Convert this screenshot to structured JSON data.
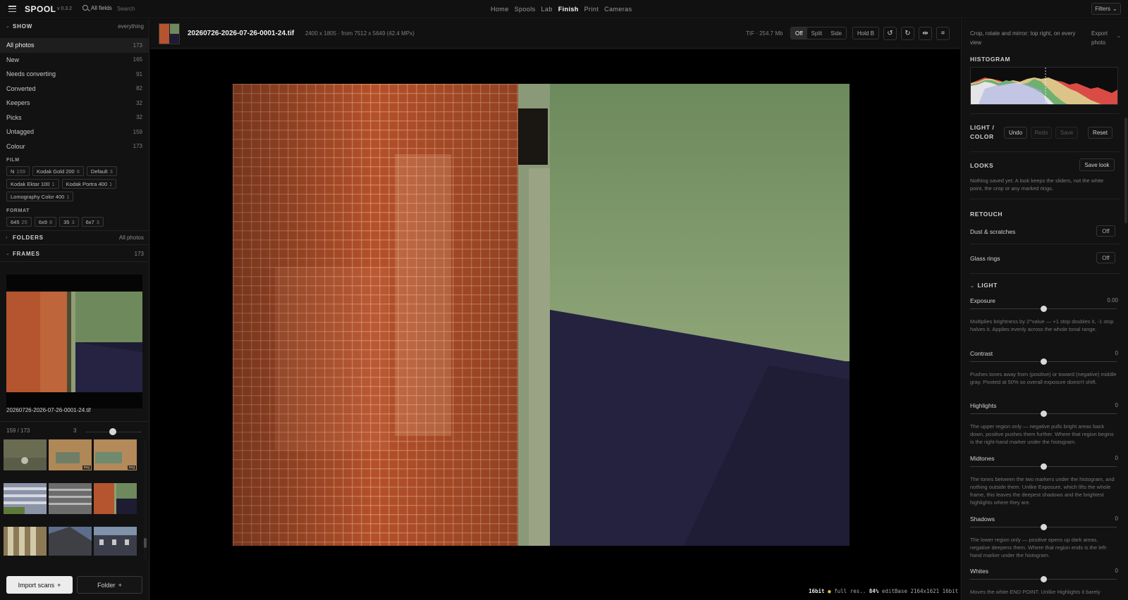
{
  "topbar": {
    "brand": "SPOOL",
    "version": "v 0.3.2",
    "search_scope": "All fields",
    "search_placeholder": "Search",
    "nav": [
      "Home",
      "Spools",
      "Lab",
      "Finish",
      "Print",
      "Cameras"
    ],
    "nav_active": "Finish",
    "filters_label": "Filters"
  },
  "sidebar": {
    "show": {
      "title": "SHOW",
      "aux": "everything"
    },
    "show_items": [
      {
        "label": "All photos",
        "count": "173"
      },
      {
        "label": "New",
        "count": "165"
      },
      {
        "label": "Needs converting",
        "count": "91"
      },
      {
        "label": "Converted",
        "count": "82"
      },
      {
        "label": "Keepers",
        "count": "32"
      },
      {
        "label": "Picks",
        "count": "32"
      },
      {
        "label": "Untagged",
        "count": "159"
      },
      {
        "label": "Colour",
        "count": "173"
      }
    ],
    "film_title": "FILM",
    "film_chips": [
      {
        "label": "N",
        "count": "159"
      },
      {
        "label": "Kodak Gold 200",
        "count": "8"
      },
      {
        "label": "Default",
        "count": "3"
      },
      {
        "label": "Kodak Ektar 100",
        "count": "1"
      },
      {
        "label": "Kodak Portra 400",
        "count": "1"
      },
      {
        "label": "Lomography Color 400",
        "count": "1"
      }
    ],
    "format_title": "FORMAT",
    "format_chips": [
      {
        "label": "645",
        "count": "25"
      },
      {
        "label": "6x9",
        "count": "8"
      },
      {
        "label": "35",
        "count": "3"
      },
      {
        "label": "6x7",
        "count": "3"
      }
    ],
    "folders": {
      "title": "FOLDERS",
      "aux": "All photos"
    },
    "frames": {
      "title": "FRAMES",
      "aux": "173"
    },
    "frame_name": "20260726-2026-07-26-0001-24.tif",
    "pager_pos": "159 / 173",
    "pager_cols": "3",
    "thumb_tag": "neg",
    "import_label": "Import scans",
    "folder_label": "Folder"
  },
  "center": {
    "file_title": "20260726-2026-07-26-0001-24.tif",
    "file_meta": "2400 x 1805 · from 7512 x 5649 (42.4 MPx)",
    "file_size": "TIF · 254.7 Mb",
    "compare_modes": [
      "Off",
      "Split",
      "Side"
    ],
    "compare_active": "Off",
    "hold_label": "Hold B",
    "status": {
      "bits": "16bit",
      "res": "full res..",
      "zoom": "84%",
      "rest": "editBase 2164x1621 16bit"
    }
  },
  "right": {
    "hint": "Crop, rotate and mirror: top right, on every view",
    "export_label": "Export photo",
    "histogram_title": "HISTOGRAM",
    "light_color_title": "LIGHT / COLOR",
    "undo": "Undo",
    "redo": "Redo",
    "save": "Save",
    "reset": "Reset",
    "looks_title": "LOOKS",
    "save_look": "Save look",
    "looks_note": "Nothing saved yet. A look keeps the sliders, not the white point, the crop or any marked rings.",
    "retouch_title": "RETOUCH",
    "dust_label": "Dust & scratches",
    "dust_state": "Off",
    "glass_label": "Glass rings",
    "glass_state": "Off",
    "light_title": "LIGHT",
    "sliders": [
      {
        "label": "Exposure",
        "value": "0.00",
        "level": 0.5,
        "desc": "Multiplies brightness by 2^value — +1 stop doubles it, -1 stop halves it. Applies evenly across the whole tonal range."
      },
      {
        "label": "Contrast",
        "value": "0",
        "level": 0.5,
        "desc": "Pushes tones away from (positive) or toward (negative) middle gray. Pivoted at 50% so overall exposure doesn't shift."
      },
      {
        "label": "Highlights",
        "value": "0",
        "level": 0.5,
        "desc": "The upper region only — negative pulls bright areas back down, positive pushes them further. Where that region begins is the right-hand marker under the histogram."
      },
      {
        "label": "Midtones",
        "value": "0",
        "level": 0.5,
        "desc": "The tones between the two markers under the histogram, and nothing outside them. Unlike Exposure, which lifts the whole frame, this leaves the deepest shadows and the brightest highlights where they are."
      },
      {
        "label": "Shadows",
        "value": "0",
        "level": 0.5,
        "desc": "The lower region only — positive opens up dark areas, negative deepens them. Where that region ends is the left-hand marker under the histogram."
      },
      {
        "label": "Whites",
        "value": "0",
        "level": 0.5,
        "desc": "Moves the white END POINT. Unlike Highlights it barely"
      }
    ]
  }
}
